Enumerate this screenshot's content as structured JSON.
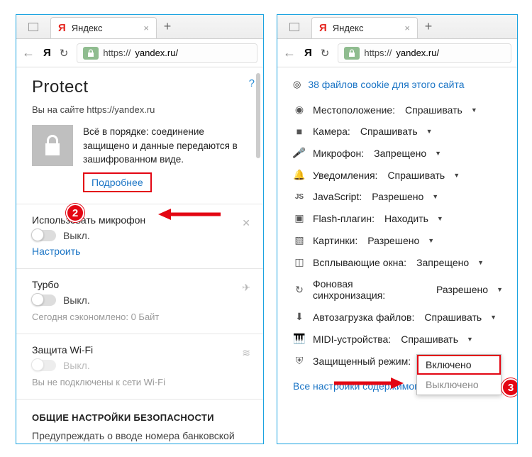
{
  "tabs": {
    "title": "Яндекс"
  },
  "url": {
    "scheme": "https://",
    "host": "yandex.ru/"
  },
  "left": {
    "heading": "Protect",
    "help": "?",
    "site_note": "Вы на сайте https://yandex.ru",
    "status_text": "Всё в порядке: соединение защищено и данные передаются в зашифрованном виде.",
    "more": "Подробнее",
    "mic": {
      "title": "Использовать микрофон",
      "state": "Выкл.",
      "configure": "Настроить"
    },
    "turbo": {
      "title": "Турбо",
      "state": "Выкл.",
      "saved": "Сегодня сэкономлено: 0 Байт"
    },
    "wifi": {
      "title": "Защита Wi-Fi",
      "state": "Выкл.",
      "note": "Вы не подключены к сети Wi-Fi"
    },
    "sec_heading": "ОБЩИЕ НАСТРОЙКИ БЕЗОПАСНОСТИ",
    "sec_line": "Предупреждать о вводе номера банковской"
  },
  "right": {
    "cookies": "38 файлов cookie для этого сайта",
    "perms": [
      {
        "icon": "pin",
        "label": "Местоположение:",
        "value": "Спрашивать"
      },
      {
        "icon": "camera",
        "label": "Камера:",
        "value": "Спрашивать"
      },
      {
        "icon": "mic",
        "label": "Микрофон:",
        "value": "Запрещено"
      },
      {
        "icon": "bell",
        "label": "Уведомления:",
        "value": "Спрашивать"
      },
      {
        "icon": "js",
        "label": "JavaScript:",
        "value": "Разрешено"
      },
      {
        "icon": "flash",
        "label": "Flash-плагин:",
        "value": "Находить"
      },
      {
        "icon": "image",
        "label": "Картинки:",
        "value": "Разрешено"
      },
      {
        "icon": "popup",
        "label": "Всплывающие окна:",
        "value": "Запрещено"
      },
      {
        "icon": "sync",
        "label": "Фоновая синхронизация:",
        "value": "Разрешено"
      },
      {
        "icon": "download",
        "label": "Автозагрузка файлов:",
        "value": "Спрашивать"
      },
      {
        "icon": "midi",
        "label": "MIDI-устройства:",
        "value": "Спрашивать"
      },
      {
        "icon": "shield",
        "label": "Защищенный режим:",
        "value": ""
      }
    ],
    "dropdown": {
      "on": "Включено",
      "off": "Выключено"
    },
    "all_settings": "Все настройки содержимого"
  },
  "badges": {
    "two": "2",
    "three": "3"
  }
}
